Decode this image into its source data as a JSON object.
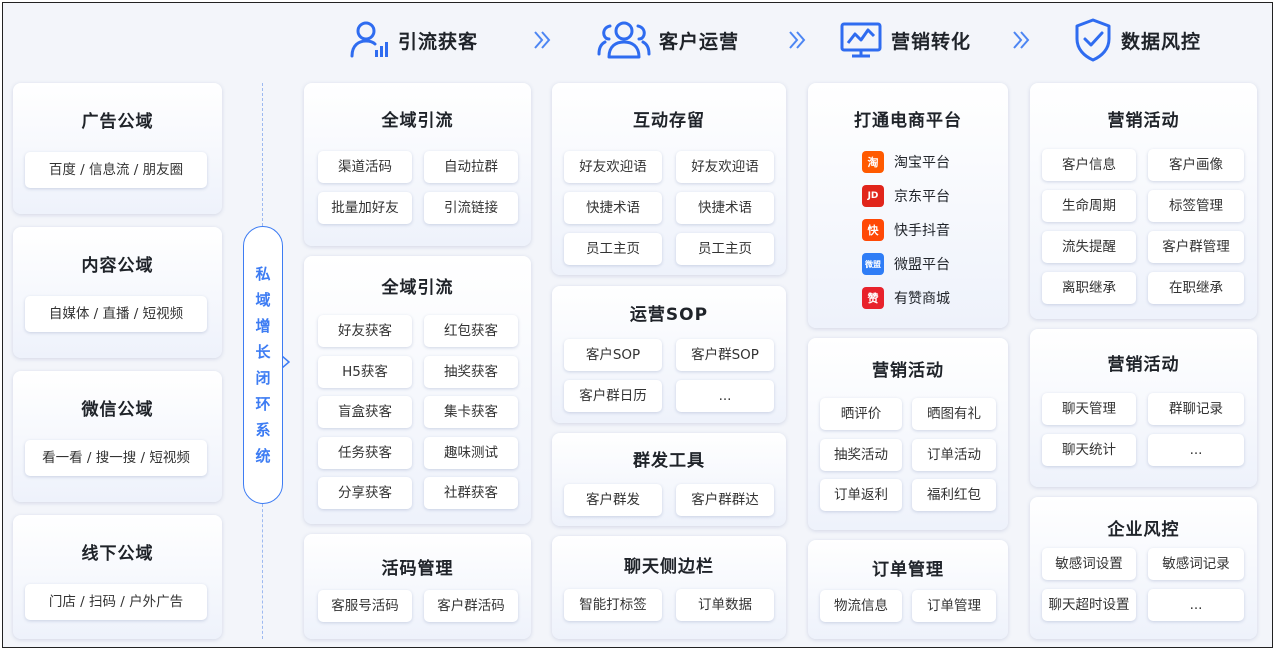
{
  "stages": [
    {
      "label": "引流获客",
      "icon": "user-chart-icon"
    },
    {
      "label": "客户运营",
      "icon": "users-icon"
    },
    {
      "label": "营销转化",
      "icon": "monitor-chart-icon"
    },
    {
      "label": "数据风控",
      "icon": "shield-check-icon"
    }
  ],
  "accent_color": "#3d7cf3",
  "domains": [
    {
      "title": "广告公域",
      "chip": "百度 / 信息流 / 朋友圈"
    },
    {
      "title": "内容公域",
      "chip": "自媒体 / 直播 / 短视频"
    },
    {
      "title": "微信公域",
      "chip": "看一看 / 搜一搜 / 短视频"
    },
    {
      "title": "线下公域",
      "chip": "门店 / 扫码 / 户外广告"
    }
  ],
  "loop_text": [
    "私",
    "域",
    "增",
    "长",
    "闭",
    "环",
    "系",
    "统"
  ],
  "col1": [
    {
      "title": "全域引流",
      "chips": [
        "渠道活码",
        "自动拉群",
        "批量加好友",
        "引流链接"
      ]
    },
    {
      "title": "全域引流",
      "chips": [
        "好友获客",
        "红包获客",
        "H5获客",
        "抽奖获客",
        "盲盒获客",
        "集卡获客",
        "任务获客",
        "趣味测试",
        "分享获客",
        "社群获客"
      ]
    },
    {
      "title": "活码管理",
      "chips": [
        "客服号活码",
        "客户群活码"
      ]
    }
  ],
  "col2": [
    {
      "title": "互动存留",
      "chips": [
        "好友欢迎语",
        "好友欢迎语",
        "快捷术语",
        "快捷术语",
        "员工主页",
        "员工主页"
      ]
    },
    {
      "title": "运营SOP",
      "chips": [
        "客户SOP",
        "客户群SOP",
        "客户群日历",
        "..."
      ]
    },
    {
      "title": "群发工具",
      "chips": [
        "客户群发",
        "客户群群达"
      ]
    },
    {
      "title": "聊天侧边栏",
      "chips": [
        "智能打标签",
        "订单数据"
      ]
    }
  ],
  "col3": {
    "platform_card": {
      "title": "打通电商平台",
      "platforms": [
        {
          "name": "淘宝平台",
          "icon_text": "淘",
          "color": "#ff5a00"
        },
        {
          "name": "京东平台",
          "icon_text": "JD",
          "color": "#e1251b"
        },
        {
          "name": "快手抖音",
          "icon_text": "快",
          "color": "#ff4906"
        },
        {
          "name": "微盟平台",
          "icon_text": "微盟",
          "color": "#2f7df6"
        },
        {
          "name": "有赞商城",
          "icon_text": "赞",
          "color": "#e8222c"
        }
      ]
    },
    "cards": [
      {
        "title": "营销活动",
        "chips": [
          "晒评价",
          "晒图有礼",
          "抽奖活动",
          "订单活动",
          "订单返利",
          "福利红包"
        ]
      },
      {
        "title": "订单管理",
        "chips": [
          "物流信息",
          "订单管理"
        ]
      }
    ]
  },
  "col4": [
    {
      "title": "营销活动",
      "chips": [
        "客户信息",
        "客户画像",
        "生命周期",
        "标签管理",
        "流失提醒",
        "客户群管理",
        "离职继承",
        "在职继承"
      ]
    },
    {
      "title": "营销活动",
      "chips": [
        "聊天管理",
        "群聊记录",
        "聊天统计",
        "..."
      ]
    },
    {
      "title": "企业风控",
      "chips": [
        "敏感词设置",
        "敏感词记录",
        "聊天超时设置",
        "..."
      ]
    }
  ]
}
